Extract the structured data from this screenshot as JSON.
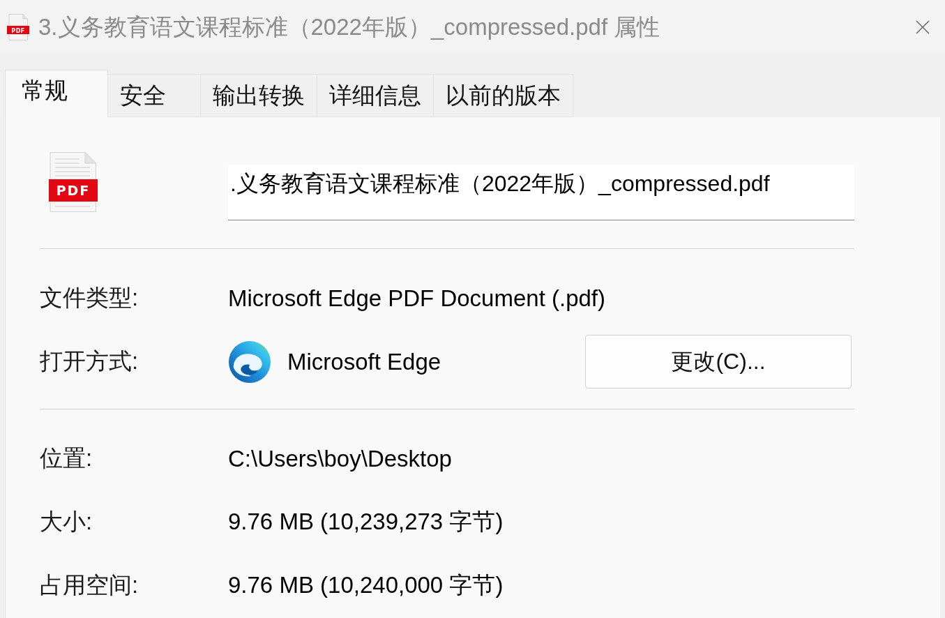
{
  "window": {
    "icon_label": "PDF",
    "title": "3.义务教育语文课程标准（2022年版）_compressed.pdf 属性"
  },
  "tabs": [
    {
      "label": "常规",
      "selected": true
    },
    {
      "label": "安全",
      "selected": false
    },
    {
      "label": "输出转换",
      "selected": false
    },
    {
      "label": "详细信息",
      "selected": false
    },
    {
      "label": "以前的版本",
      "selected": false
    }
  ],
  "file": {
    "icon_label": "PDF",
    "name": ".义务教育语文课程标准（2022年版）_compressed.pdf"
  },
  "groups": [
    {
      "rows": [
        {
          "kind": "text",
          "label": "文件类型:",
          "value": "Microsoft Edge PDF Document (.pdf)"
        },
        {
          "kind": "app",
          "label": "打开方式:",
          "value": "Microsoft Edge",
          "button": "更改(C)..."
        }
      ]
    },
    {
      "rows": [
        {
          "kind": "text",
          "label": "位置:",
          "value": "C:\\Users\\boy\\Desktop"
        },
        {
          "kind": "text",
          "label": "大小:",
          "value": "9.76 MB (10,239,273 字节)"
        },
        {
          "kind": "text",
          "label": "占用空间:",
          "value": "9.76 MB (10,240,000 字节)"
        }
      ]
    }
  ]
}
